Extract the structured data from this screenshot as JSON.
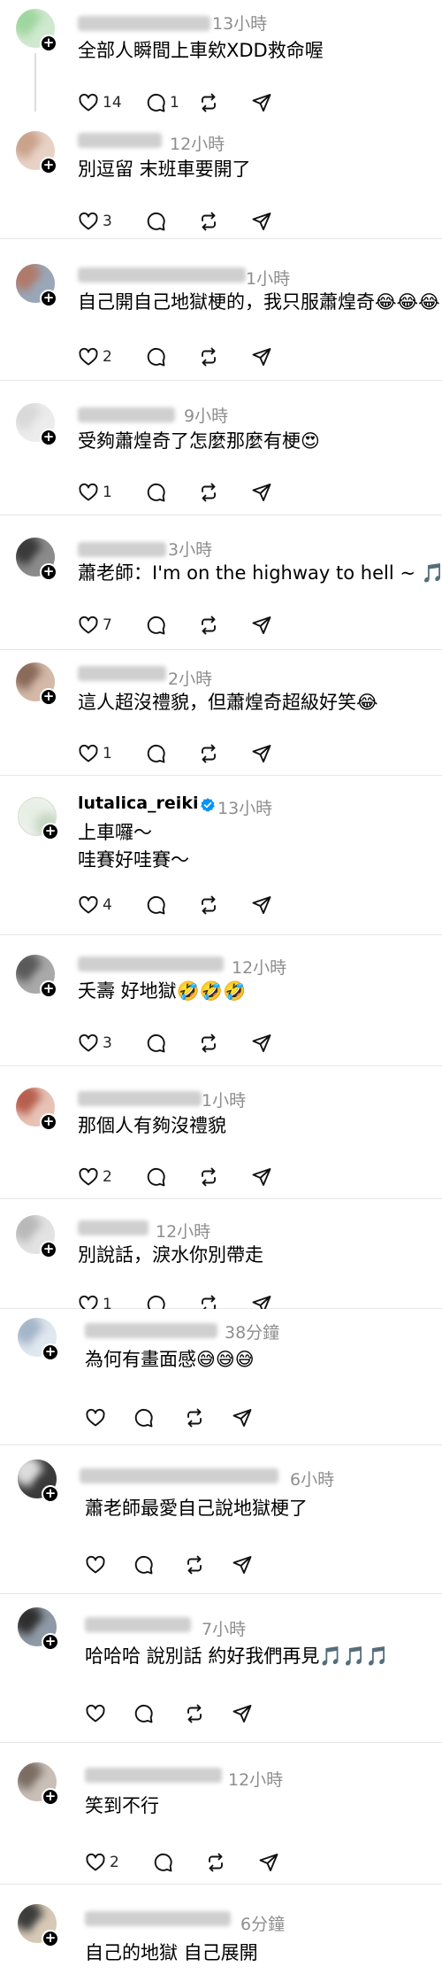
{
  "comments": [
    {
      "id": "c1",
      "time": "13小時",
      "text": [
        "全部人瞬間上車欸XDD救命喔"
      ],
      "likes": "14",
      "replies": "1"
    },
    {
      "id": "c2",
      "time": "12小時",
      "text": [
        "別逗留 末班車要開了"
      ],
      "likes": "3",
      "replies": ""
    },
    {
      "id": "c3",
      "time": "1小時",
      "text": [
        "自己開自己地獄梗的，我只服蕭煌奇😂😂😂"
      ],
      "likes": "2",
      "replies": ""
    },
    {
      "id": "c4",
      "time": "9小時",
      "text": [
        "受夠蕭煌奇了怎麼那麼有梗😍"
      ],
      "likes": "1",
      "replies": ""
    },
    {
      "id": "c5",
      "time": "3小時",
      "text": [
        "蕭老師：I'm on the highway to hell ~ 🎵"
      ],
      "likes": "7",
      "replies": ""
    },
    {
      "id": "c6",
      "time": "2小時",
      "text": [
        "這人超沒禮貌，但蕭煌奇超級好笑😂"
      ],
      "likes": "1",
      "replies": ""
    },
    {
      "id": "c7",
      "username": "lutalica_reiki",
      "time": "13小時",
      "text": [
        "上車囉～",
        "哇賽好哇賽～"
      ],
      "likes": "4",
      "replies": ""
    },
    {
      "id": "c8",
      "time": "12小時",
      "text": [
        "夭壽 好地獄🤣🤣🤣"
      ],
      "likes": "3",
      "replies": ""
    },
    {
      "id": "c9",
      "time": "1小時",
      "text": [
        "那個人有夠沒禮貌"
      ],
      "likes": "2",
      "replies": ""
    },
    {
      "id": "c10",
      "time": "12小時",
      "text": [
        "別說話，淚水你別帶走"
      ],
      "likes": "1",
      "replies": ""
    },
    {
      "id": "c11",
      "time": "38分鐘",
      "text": [
        "為何有畫面感😅😅😅"
      ],
      "likes": "",
      "replies": ""
    },
    {
      "id": "c12",
      "time": "6小時",
      "text": [
        "蕭老師最愛自己說地獄梗了"
      ],
      "likes": "",
      "replies": ""
    },
    {
      "id": "c13",
      "time": "7小時",
      "text": [
        "哈哈哈 說別話 約好我們再見🎵🎵🎵"
      ],
      "likes": "",
      "replies": ""
    },
    {
      "id": "c14",
      "time": "12小時",
      "text": [
        "笑到不行"
      ],
      "likes": "2",
      "replies": ""
    },
    {
      "id": "c15",
      "time": "6分鐘",
      "text": [
        "自己的地獄 自己展開"
      ],
      "likes": "",
      "replies": ""
    }
  ],
  "icons": {
    "like": "heart-icon",
    "reply": "comment-icon",
    "repost": "repost-icon",
    "share": "send-icon",
    "follow": "plus-icon",
    "verified": "verified-badge-icon"
  },
  "colors": {
    "verified": "#0095f6",
    "time": "#8e8e8e",
    "divider": "#e6e6e6"
  }
}
